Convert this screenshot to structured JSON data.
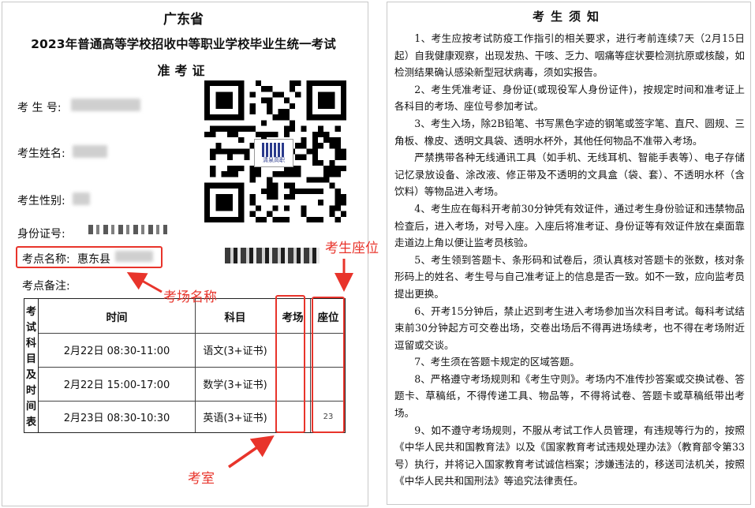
{
  "left": {
    "province": "广东省",
    "exam_title": "2023年普通高等学校招收中等职业学校毕业生统一考试",
    "ticket_title": "准考证",
    "labels": {
      "exam_no": "考 生 号:",
      "name": "考生姓名:",
      "gender": "考生性别:",
      "id_no": "身份证号:",
      "site_name": "考点名称:",
      "site_note": "考点备注:"
    },
    "site_name_value": "惠东县",
    "qr_logo_text": "清泉高职",
    "annotations": {
      "room_name": "考场名称",
      "seat": "考生座位",
      "classroom": "考室"
    },
    "schedule": {
      "side_label": [
        "考",
        "试",
        "科",
        "目",
        "及",
        "时",
        "间",
        "表"
      ],
      "headers": {
        "time": "时间",
        "subject": "科目",
        "room": "考场",
        "seat": "座位"
      },
      "rows": [
        {
          "time": "2月22日  08:30-11:00",
          "subject": "语文(3+证书)",
          "room": "",
          "seat": ""
        },
        {
          "time": "2月22日  15:00-17:00",
          "subject": "数学(3+证书)",
          "room": "",
          "seat": ""
        },
        {
          "time": "2月23日  08:30-10:30",
          "subject": "英语(3+证书)",
          "room": "",
          "seat": "23"
        }
      ]
    }
  },
  "right": {
    "title": "考生须知",
    "paragraphs": [
      "1、考生应按考试防疫工作指引的相关要求，进行考前连续7天（2月15日起）自我健康观察，出现发热、干咳、乏力、咽痛等症状要检测抗原或核酸，如检测结果确认感染新型冠状病毒，须如实报告。",
      "2、考生凭准考证、身份证(或现役军人身份证件)，按规定时间和准考证上各科目的考场、座位号参加考试。",
      "3、考生入场，除2B铅笔、书写黑色字迹的钢笔或签字笔、直尺、圆规、三角板、橡皮、透明文具袋、透明水杯外，其他任何物品不准带入考场。",
      "严禁携带各种无线通讯工具（如手机、无线耳机、智能手表等）、电子存储记忆录放设备、涂改液、修正带及不透明的文具盒（袋、套）、不透明水杯（含饮料）等物品进入考场。",
      "4、考生应在每科开考前30分钟凭有效证件，通过考生身份验证和违禁物品检查后，进入考场，对号入座。入座后将准考证、身份证等有效证件放在桌面靠走道边上角以便让监考员核验。",
      "5、考生领到答题卡、条形码和试卷后，须认真核对答题卡的张数，核对条形码上的姓名、考生号与自己准考证上的信息是否一致。如不一致，应向监考员提出更换。",
      "6、开考15分钟后，禁止迟到考生进入考场参加当次科目考试。每科考试结束前30分钟起方可交卷出场，交卷出场后不得再进场续考，也不得在考场附近逗留或交谈。",
      "7、考生须在答题卡规定的区域答题。",
      "8、严格遵守考场规则和《考生守则》。考场内不准传抄答案或交换试卷、答题卡、草稿纸，不得传递工具、物品等，不得将试卷、答题卡或草稿纸带出考场。",
      "9、如不遵守考场规则，不服从考试工作人员管理，有违规等行为的，按照《中华人民共和国教育法》以及《国家教育考试违规处理办法》（教育部令第33号）执行，并将记入国家教育考试诚信档案；涉嫌违法的，移送司法机关，按照《中华人民共和国刑法》等追究法律责任。"
    ]
  },
  "colors": {
    "annotation_red": "#e8342b",
    "logo_blue": "#2a3a8c"
  }
}
